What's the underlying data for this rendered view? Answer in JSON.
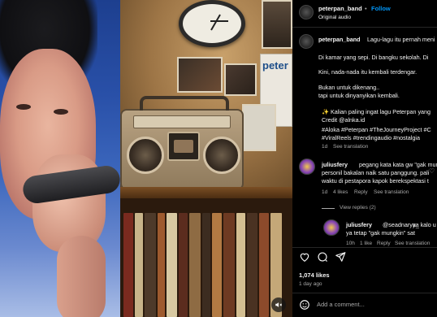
{
  "header": {
    "username": "peterpan_band",
    "separator": "•",
    "follow_label": "Follow",
    "subtitle": "Original audio"
  },
  "caption": {
    "username": "peterpan_band",
    "lines": [
      "Lagu-lagu itu pernah meni",
      "Di kamar yang sepi. Di bangku sekolah. Di",
      "Kini, nada-nada itu kembali terdengar.",
      "Bukan untuk dikenang..",
      "tapi untuk dinyanyikan kembali.",
      "✨ Kalian paling ingat lagu Peterpan yang",
      "Credit @alnka.id",
      "#Aloka #Peterpan #TheJourneyProject #C",
      "#ViralReels #trendingaudio #nostalgia"
    ],
    "time": "1d",
    "see_translation": "See translation"
  },
  "comments": [
    {
      "username": "juliusfery",
      "text_lines": [
        "pegang kata kata gw \"gak mungk",
        "personil bakalan naik satu panggung. pali",
        "waktu di pestapora kapok berekspektasi t"
      ],
      "time": "1d",
      "likes": "4 likes",
      "reply": "Reply",
      "see_translation": "See translation",
      "view_replies": "View replies (2)"
    },
    {
      "username": "juliusfery",
      "mention": "@seadnarya_",
      "text_lines": [
        "ya kalo u",
        "ya tetap \"gak mungkin\" sat"
      ],
      "time": "10h",
      "likes": "1 like",
      "reply": "Reply",
      "see_translation": "See translation"
    }
  ],
  "actions": {
    "likes_count": "1,074 likes",
    "time_ago": "1 day ago",
    "comment_placeholder": "Add a comment..."
  },
  "scene": {
    "poster_text": "peter",
    "mute_icon": "speaker-off-icon"
  },
  "colors": {
    "accent": "#0095f6",
    "background": "#000000",
    "muted": "#a8a8a8"
  }
}
